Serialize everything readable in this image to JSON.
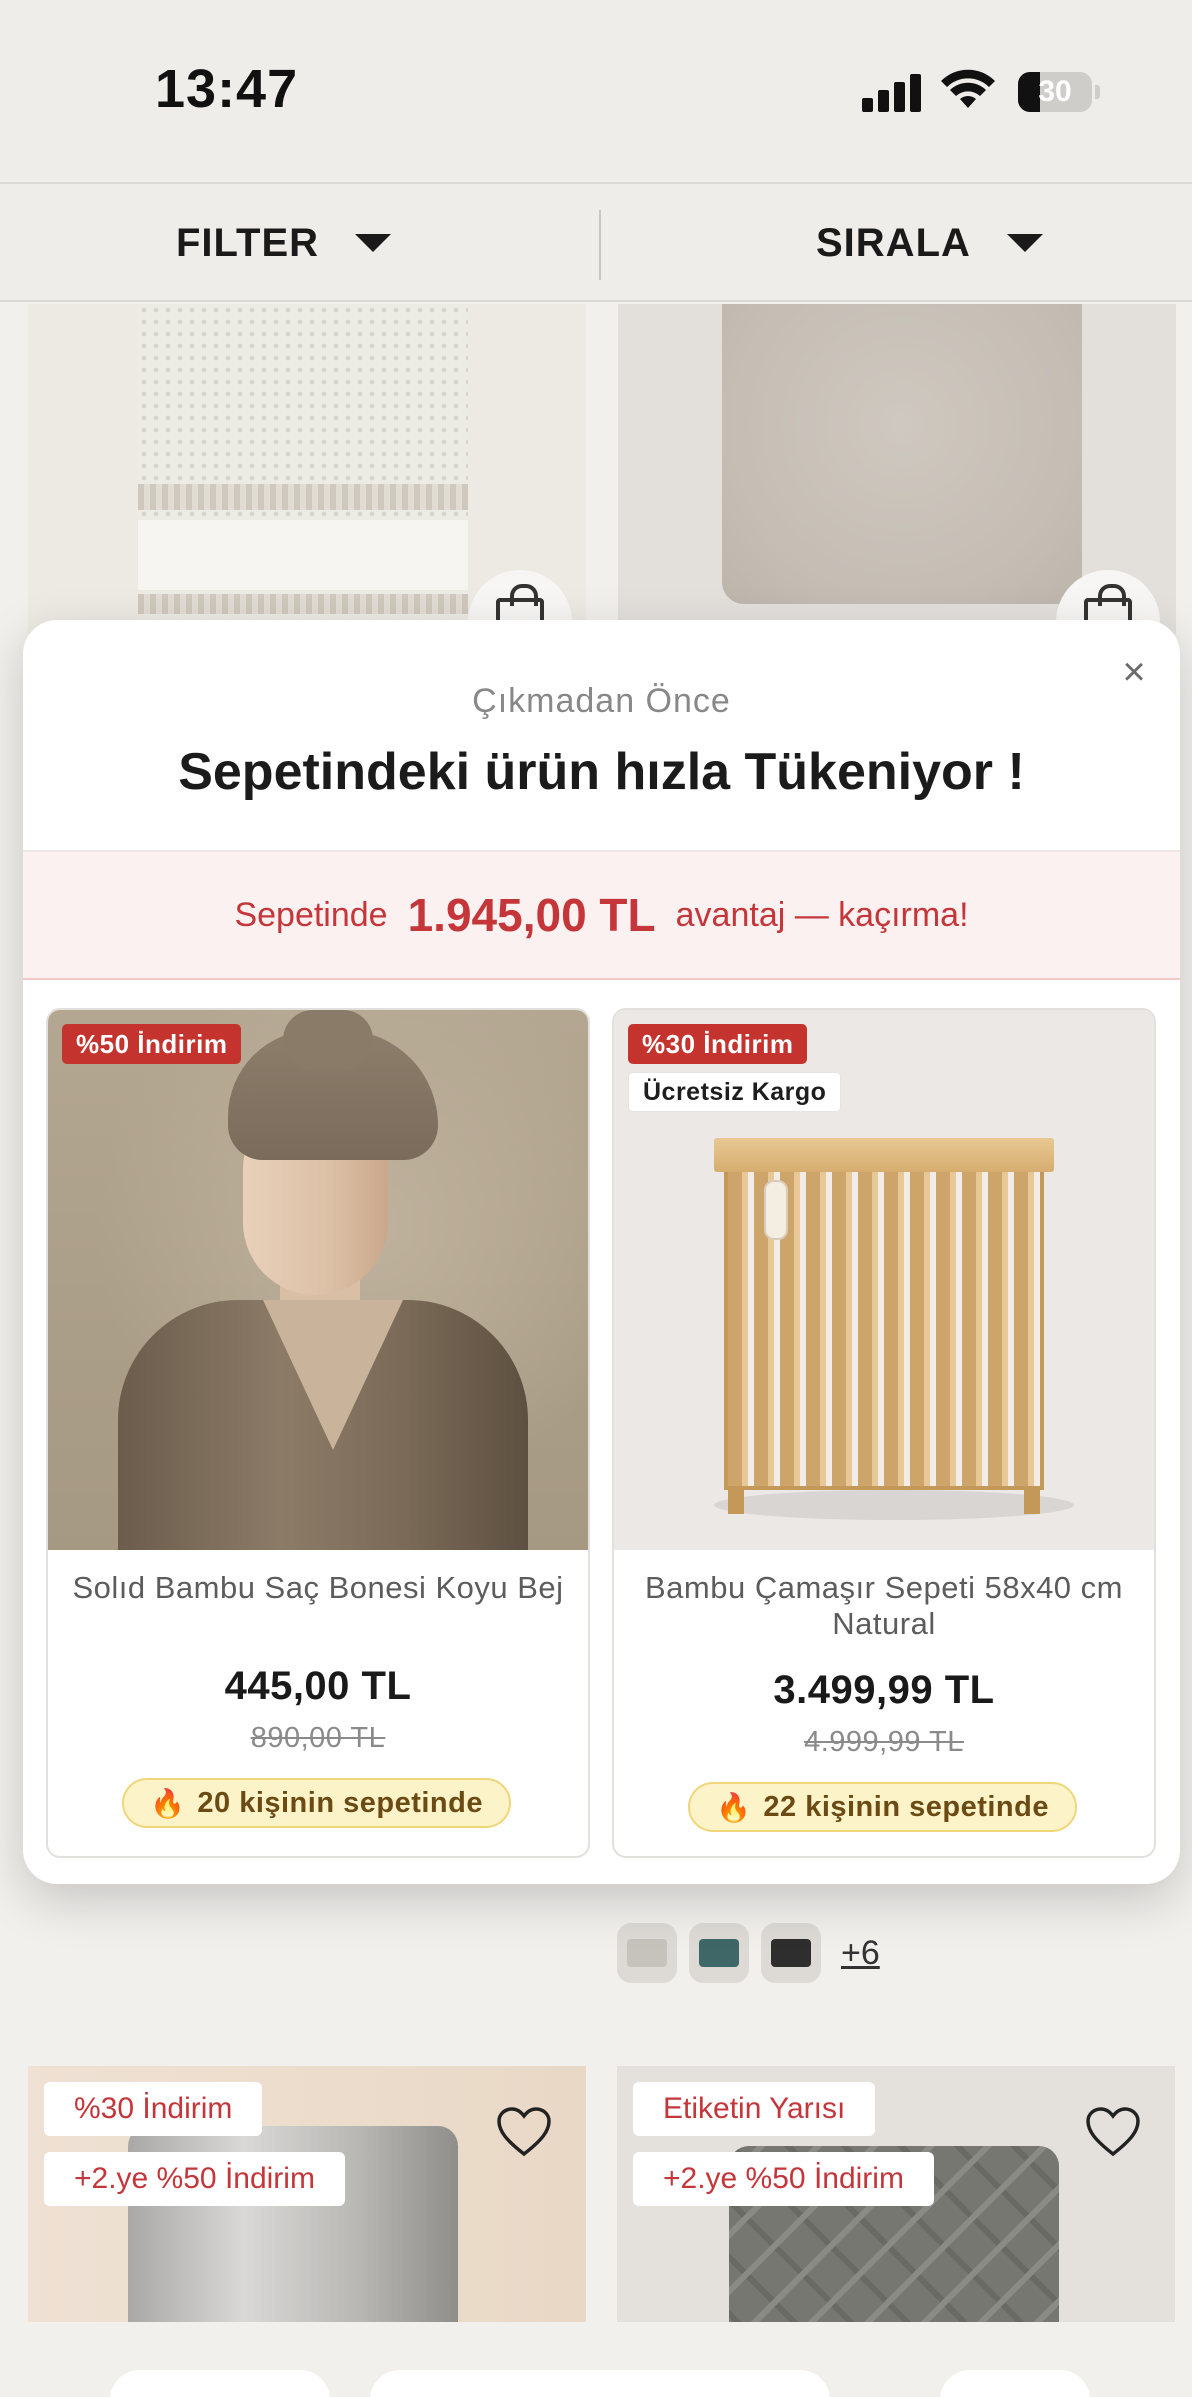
{
  "status_bar": {
    "time": "13:47",
    "battery": "30"
  },
  "filter_bar": {
    "filter_label": "FILTER",
    "sort_label": "SIRALA"
  },
  "grid": {
    "more_colors": "+6",
    "tile_left_tags": [
      "%30 İndirim",
      "+2.ye %50 İndirim"
    ],
    "tile_right_tags": [
      "Etiketin Yarısı",
      "+2.ye %50 İndirim"
    ]
  },
  "popup": {
    "close_icon": "×",
    "pre_title": "Çıkmadan Önce",
    "title": "Sepetindeki ürün hızla Tükeniyor !",
    "promo": {
      "before": "Sepetinde",
      "amount": "1.945,00 TL",
      "after": "avantaj — kaçırma!"
    },
    "products": [
      {
        "badge": "%50 İndirim",
        "name": "Solıd Bambu Saç Bonesi Koyu Bej",
        "price": "445,00 TL",
        "old_price": "890,00 TL",
        "cart_note": "20 kişinin sepetinde"
      },
      {
        "badge": "%30 İndirim",
        "badge_2": "Ücretsiz Kargo",
        "name": "Bambu Çamaşır Sepeti 58x40 cm Natural",
        "price": "3.499,99 TL",
        "old_price": "4.999,99 TL",
        "cart_note": "22 kişinin sepetinde"
      }
    ]
  },
  "colors": {
    "accent_red": "#c4363a",
    "badge_red": "#c4332e",
    "promo_bg": "#fbf1f0",
    "cart_pill_bg": "#fdf3c9"
  },
  "icons": {
    "signal": "cellular-signal-icon",
    "wifi": "wifi-icon",
    "battery": "battery-icon",
    "caret": "caret-down-icon",
    "bag": "shopping-bag-icon",
    "heart": "heart-icon",
    "fire": "fire-icon",
    "close": "close-icon"
  }
}
